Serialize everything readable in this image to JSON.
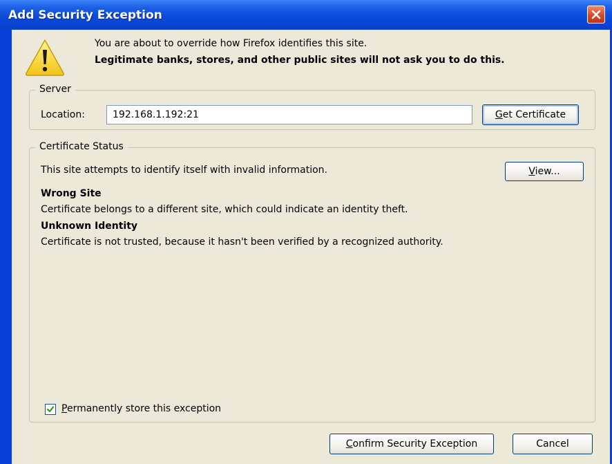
{
  "window": {
    "title": "Add Security Exception"
  },
  "message": {
    "line1": "You are about to override how Firefox identifies this site.",
    "line2": "Legitimate banks, stores, and other public sites will not ask you to do this."
  },
  "server": {
    "legend": "Server",
    "location_label": "Location:",
    "location_value": "192.168.1.192:21",
    "get_certificate_button": {
      "mnemonic": "G",
      "rest": "et Certificate"
    }
  },
  "certificate_status": {
    "legend": "Certificate Status",
    "summary": "This site attempts to identify itself with invalid information.",
    "view_button": {
      "mnemonic": "V",
      "rest": "iew..."
    },
    "issues": [
      {
        "heading": "Wrong Site",
        "text": "Certificate belongs to a different site, which could indicate an identity theft."
      },
      {
        "heading": "Unknown Identity",
        "text": "Certificate is not trusted, because it hasn't been verified by a recognized authority."
      }
    ],
    "permanent_store": {
      "checked": true,
      "mnemonic": "P",
      "rest": "ermanently store this exception"
    }
  },
  "buttons": {
    "confirm": {
      "mnemonic": "C",
      "rest": "onfirm Security Exception"
    },
    "cancel": "Cancel"
  },
  "colors": {
    "titlebar": "#0a49d9",
    "dialog_bg": "#ece9d8",
    "close_button": "#d8462a"
  },
  "icons": {
    "warning": "warning-icon",
    "close": "close-icon",
    "check": "checkmark-icon"
  }
}
